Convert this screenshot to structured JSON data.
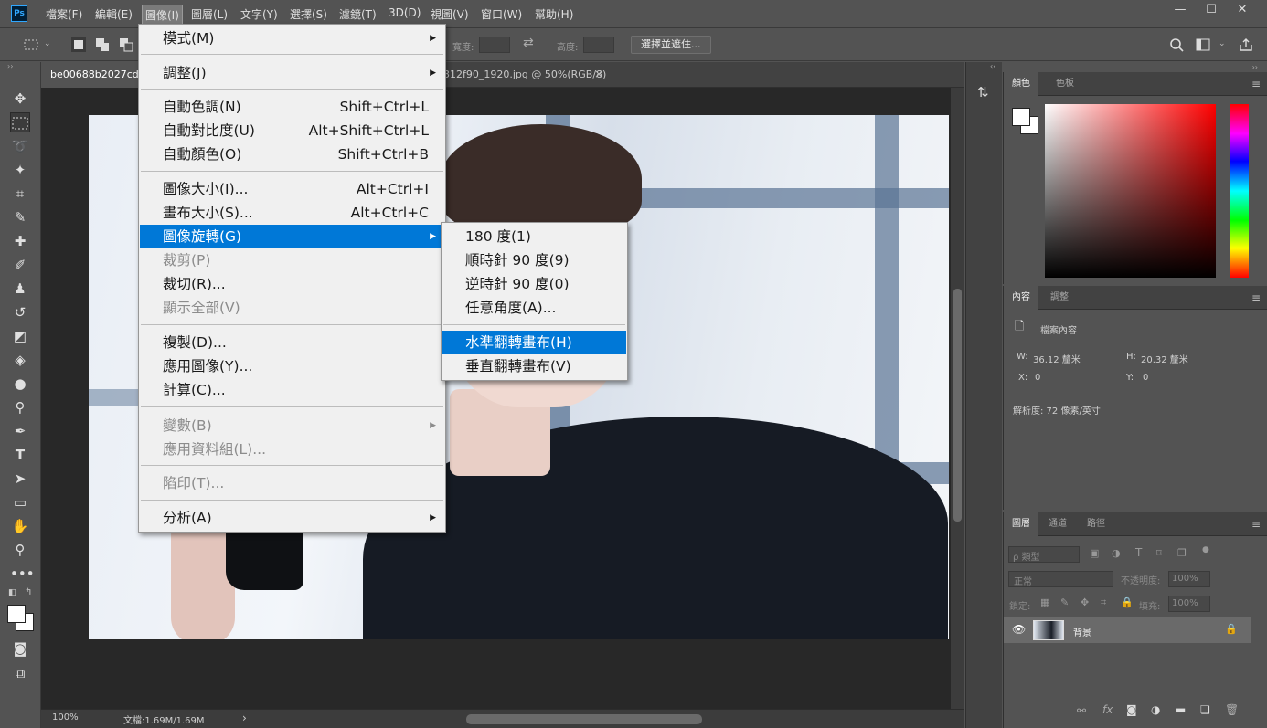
{
  "app": {
    "logo": "Ps"
  },
  "menubar": {
    "items": [
      "檔案(F)",
      "編輯(E)",
      "圖像(I)",
      "圖層(L)",
      "文字(Y)",
      "選擇(S)",
      "濾鏡(T)",
      "3D(D)",
      "視圖(V)",
      "窗口(W)",
      "幫助(H)"
    ],
    "active_index": 2
  },
  "window_controls": {
    "minimize": "—",
    "maximize": "☐",
    "close": "✕"
  },
  "options_bar": {
    "width_label": "寬度:",
    "height_label": "高度:",
    "select_mask_button": "選擇並遮住..."
  },
  "tabs": [
    {
      "label": "be00688b2027cddd"
    },
    {
      "label": "312f90_1920.jpg @ 50%(RGB/8)"
    }
  ],
  "tab_close": "×",
  "status": {
    "zoom": "100%",
    "doc": "文檔:1.69M/1.69M",
    "arrow": "›"
  },
  "image_menu": {
    "items": [
      {
        "label": "模式(M)",
        "shortcut": "",
        "submenu": true,
        "disabled": false
      },
      {
        "label": "調整(J)",
        "shortcut": "",
        "submenu": true,
        "disabled": false
      },
      {
        "label": "自動色調(N)",
        "shortcut": "Shift+Ctrl+L",
        "submenu": false,
        "disabled": false
      },
      {
        "label": "自動對比度(U)",
        "shortcut": "Alt+Shift+Ctrl+L",
        "submenu": false,
        "disabled": false
      },
      {
        "label": "自動顏色(O)",
        "shortcut": "Shift+Ctrl+B",
        "submenu": false,
        "disabled": false
      },
      {
        "label": "圖像大小(I)...",
        "shortcut": "Alt+Ctrl+I",
        "submenu": false,
        "disabled": false
      },
      {
        "label": "畫布大小(S)...",
        "shortcut": "Alt+Ctrl+C",
        "submenu": false,
        "disabled": false
      },
      {
        "label": "圖像旋轉(G)",
        "shortcut": "",
        "submenu": true,
        "disabled": false,
        "highlight": true
      },
      {
        "label": "裁剪(P)",
        "shortcut": "",
        "submenu": false,
        "disabled": true
      },
      {
        "label": "裁切(R)...",
        "shortcut": "",
        "submenu": false,
        "disabled": false
      },
      {
        "label": "顯示全部(V)",
        "shortcut": "",
        "submenu": false,
        "disabled": true
      },
      {
        "label": "複製(D)...",
        "shortcut": "",
        "submenu": false,
        "disabled": false
      },
      {
        "label": "應用圖像(Y)...",
        "shortcut": "",
        "submenu": false,
        "disabled": false
      },
      {
        "label": "計算(C)...",
        "shortcut": "",
        "submenu": false,
        "disabled": false
      },
      {
        "label": "變數(B)",
        "shortcut": "",
        "submenu": true,
        "disabled": true
      },
      {
        "label": "應用資料組(L)...",
        "shortcut": "",
        "submenu": false,
        "disabled": true
      },
      {
        "label": "陷印(T)...",
        "shortcut": "",
        "submenu": false,
        "disabled": true
      },
      {
        "label": "分析(A)",
        "shortcut": "",
        "submenu": true,
        "disabled": false
      }
    ]
  },
  "rotate_submenu": {
    "items": [
      {
        "label": "180 度(1)",
        "highlight": false
      },
      {
        "label": "順時針 90 度(9)",
        "highlight": false
      },
      {
        "label": "逆時針 90 度(0)",
        "highlight": false
      },
      {
        "label": "任意角度(A)...",
        "highlight": false
      },
      {
        "label": "水準翻轉畫布(H)",
        "highlight": true
      },
      {
        "label": "垂直翻轉畫布(V)",
        "highlight": false
      }
    ]
  },
  "color_panel": {
    "tabs": [
      "顏色",
      "色板"
    ]
  },
  "properties_panel": {
    "tabs": [
      "內容",
      "調整"
    ],
    "doc_props": "檔案內容",
    "w_label": "W:",
    "w_value": "36.12 釐米",
    "h_label": "H:",
    "h_value": "20.32 釐米",
    "x_label": "X:",
    "x_value": "0",
    "y_label": "Y:",
    "y_value": "0",
    "resolution": "解析度: 72 像素/英寸"
  },
  "layers_panel": {
    "tabs": [
      "圖層",
      "通道",
      "路徑"
    ],
    "filter_label": "ρ 類型",
    "blend_mode": "正常",
    "opacity_label": "不透明度:",
    "opacity_value": "100%",
    "lock_label": "鎖定:",
    "fill_label": "填充:",
    "fill_value": "100%",
    "layer_name": "背景"
  },
  "colors": {
    "accent": "#0078d7",
    "menu_bg": "#f0f0f0",
    "ui_bg": "#535353"
  }
}
